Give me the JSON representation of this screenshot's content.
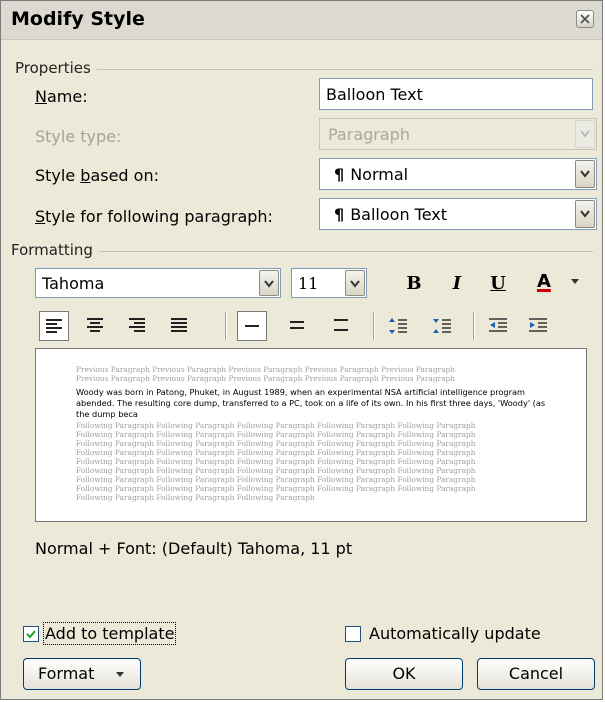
{
  "dialog": {
    "title": "Modify Style"
  },
  "properties": {
    "group_label": "Properties",
    "name_label": "Name:",
    "name_value": "Balloon Text",
    "style_type_label": "Style type:",
    "style_type_value": "Paragraph",
    "based_on_label": "Style based on:",
    "based_on_value": "Normal",
    "following_label": "Style for following paragraph:",
    "following_value": "Balloon Text",
    "pilcrow": "¶"
  },
  "formatting": {
    "group_label": "Formatting",
    "font_name": "Tahoma",
    "font_size": "11",
    "bold_glyph": "B",
    "italic_glyph": "I",
    "underline_glyph": "U",
    "font_color_glyph": "A",
    "font_color_accent": "#cc0000"
  },
  "preview": {
    "previous_lines": [
      "Previous Paragraph Previous Paragraph Previous Paragraph Previous Paragraph Previous Paragraph",
      "Previous Paragraph Previous Paragraph Previous Paragraph Previous Paragraph Previous Paragraph"
    ],
    "sample_text": "Woody was born in Patong, Phuket, in August 1989, when an experimental NSA artificial intelligence program abended. The resulting core dump, transferred to a PC, took on a life of its own. In his first three days, 'Woody' (as the dump beca",
    "following_lines": [
      "Following Paragraph Following Paragraph Following Paragraph Following Paragraph Following Paragraph",
      "Following Paragraph Following Paragraph Following Paragraph Following Paragraph Following Paragraph",
      "Following Paragraph Following Paragraph Following Paragraph Following Paragraph Following Paragraph",
      "Following Paragraph Following Paragraph Following Paragraph Following Paragraph Following Paragraph",
      "Following Paragraph Following Paragraph Following Paragraph Following Paragraph Following Paragraph",
      "Following Paragraph Following Paragraph Following Paragraph Following Paragraph Following Paragraph",
      "Following Paragraph Following Paragraph Following Paragraph Following Paragraph Following Paragraph",
      "Following Paragraph Following Paragraph Following Paragraph Following Paragraph Following Paragraph",
      "Following Paragraph Following Paragraph Following Paragraph"
    ]
  },
  "description": "Normal + Font: (Default) Tahoma, 11 pt",
  "options": {
    "add_to_template_label": "Add to template",
    "add_to_template_checked": true,
    "auto_update_label": "Automatically update",
    "auto_update_checked": false
  },
  "buttons": {
    "format_label": "Format",
    "ok_label": "OK",
    "cancel_label": "Cancel"
  }
}
